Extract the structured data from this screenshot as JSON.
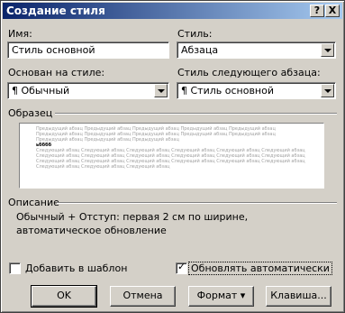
{
  "title": "Создание стиля",
  "help_btn": "?",
  "close_btn": "X",
  "name": {
    "label": "Имя:",
    "value": "Стиль основной"
  },
  "style_type": {
    "label": "Стиль:",
    "value": "Абзаца"
  },
  "based_on": {
    "label": "Основан на стиле:",
    "value": "¶ Обычный"
  },
  "next_style": {
    "label": "Стиль следующего абзаца:",
    "value": "¶ Стиль основной"
  },
  "preview": {
    "label": "Образец",
    "prev_text": "Предыдущий абзац Предыдущий абзац Предыдущий абзац Предыдущий абзац Предыдущий абзац Предыдущий абзац Предыдущий абзац Предыдущий абзац Предыдущий абзац Предыдущий абзац Предыдущий абзац Предыдущий абзац Предыдущий абзац",
    "current_text": "ьбббб",
    "next_text": "Следующий абзац Следующий абзац Следующий абзац Следующий абзац Следующий абзац Следующий абзац Следующий абзац Следующий абзац Следующий абзац Следующий абзац Следующий абзац Следующий абзац Следующий абзац Следующий абзац Следующий абзац Следующий абзац Следующий абзац Следующий абзац Следующий абзац Следующий абзац Следующий абзац"
  },
  "description": {
    "label": "Описание",
    "text": "Обычный + Отступ:  первая  2 см по ширине, автоматическое обновление"
  },
  "add_to_template": {
    "label": "Добавить в шаблон",
    "checked": false
  },
  "auto_update": {
    "label": "Обновлять автоматически",
    "checked": true
  },
  "buttons": {
    "ok": "OK",
    "cancel": "Отмена",
    "format": "Формат ▾",
    "keys": "Клавиша..."
  }
}
